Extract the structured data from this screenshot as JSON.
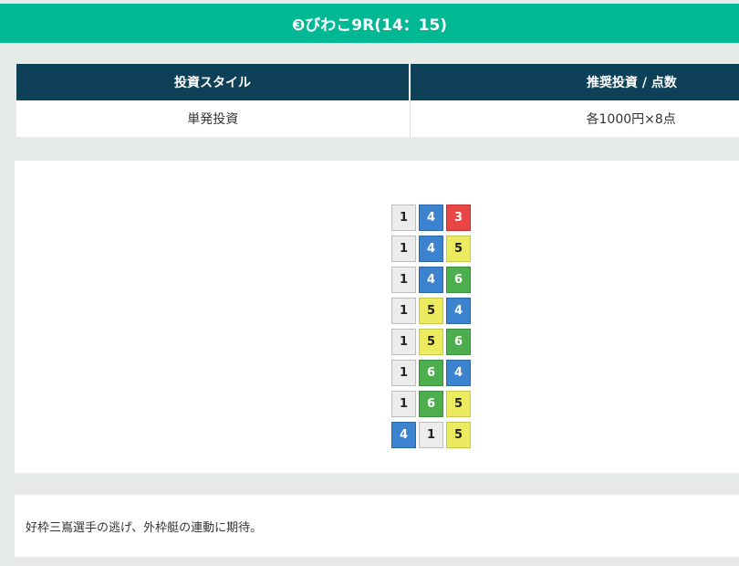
{
  "header": {
    "title": "❸びわこ9R(14：15)"
  },
  "bet_table": {
    "col_style": "投資スタイル",
    "col_amount": "推奨投資 / 点数",
    "style_value": "単発投資",
    "amount_value": "各1000円×8点"
  },
  "picks": [
    [
      "1",
      "4",
      "3"
    ],
    [
      "1",
      "4",
      "5"
    ],
    [
      "1",
      "4",
      "6"
    ],
    [
      "1",
      "5",
      "4"
    ],
    [
      "1",
      "5",
      "6"
    ],
    [
      "1",
      "6",
      "4"
    ],
    [
      "1",
      "6",
      "5"
    ],
    [
      "4",
      "1",
      "5"
    ]
  ],
  "boat_colors": {
    "1": "#ececec",
    "3": "#e84545",
    "4": "#3b82cf",
    "5": "#ecea5e",
    "6": "#4cae4c"
  },
  "comment": "好枠三嶌選手の逃げ、外枠艇の連動に期待。"
}
